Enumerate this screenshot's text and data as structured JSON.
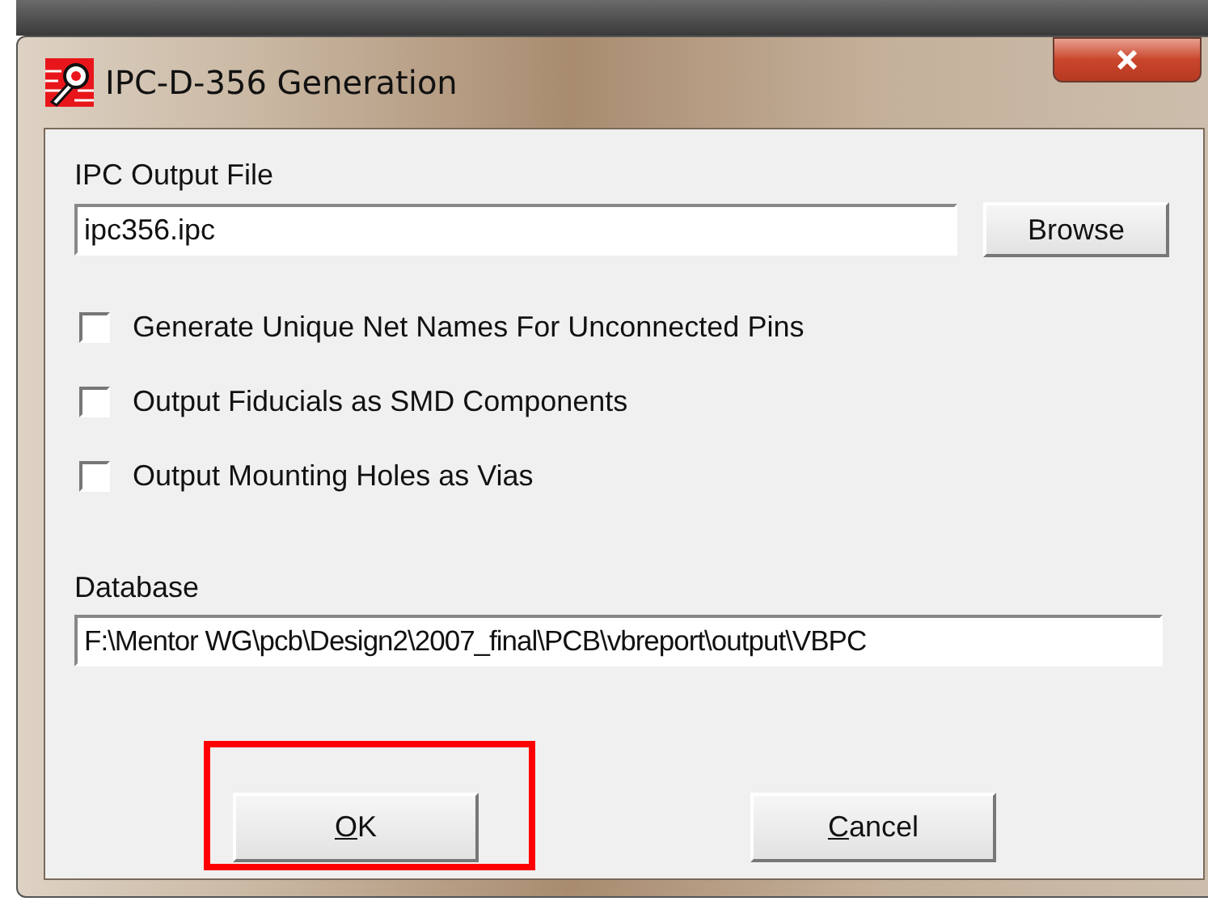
{
  "window": {
    "title": "IPC-D-356 Generation"
  },
  "output_file": {
    "label": "IPC Output File",
    "value": "ipc356.ipc",
    "browse_button": "Browse"
  },
  "options": [
    {
      "label": "Generate Unique Net Names For Unconnected Pins",
      "checked": false
    },
    {
      "label": "Output Fiducials as SMD Components",
      "checked": false
    },
    {
      "label": "Output Mounting Holes as Vias",
      "checked": false
    }
  ],
  "database": {
    "label": "Database",
    "value": "F:\\Mentor WG\\pcb\\Design2\\2007_final\\PCB\\vbreport\\output\\VBPC"
  },
  "buttons": [
    {
      "label": "OK",
      "underline_first": true,
      "highlighted": true
    },
    {
      "label": "Cancel",
      "underline_first": true,
      "highlighted": false
    }
  ]
}
